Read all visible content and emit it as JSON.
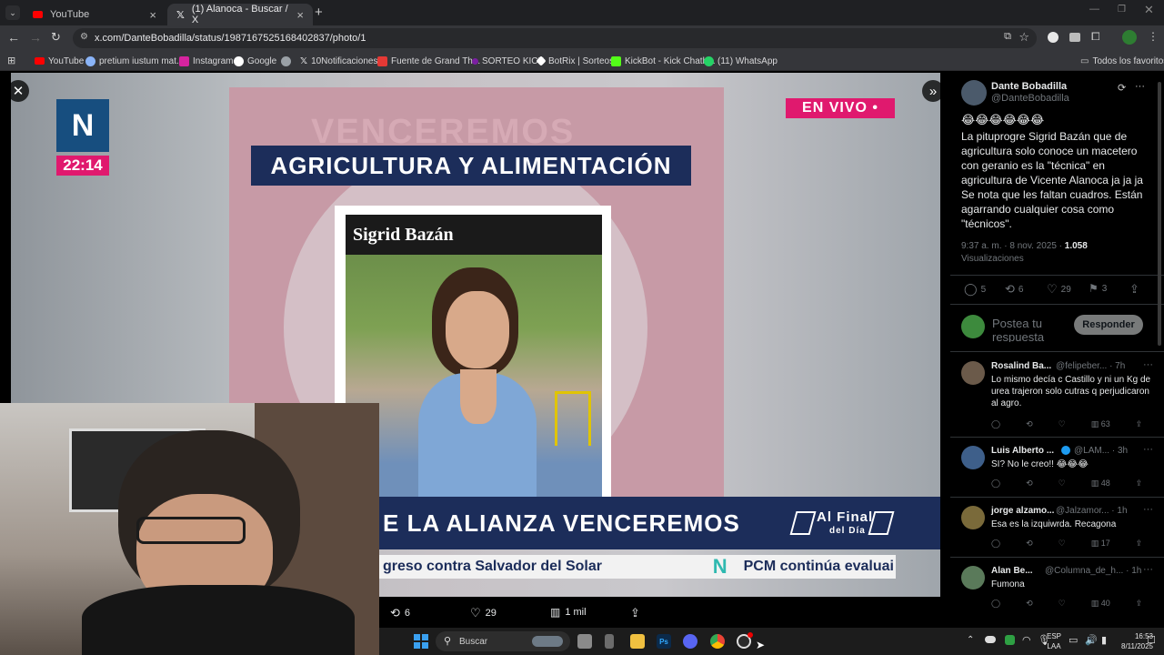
{
  "browser": {
    "tabs": [
      {
        "label": "YouTube",
        "active": false
      },
      {
        "label": "(1) Alanoca - Buscar / X",
        "active": true
      }
    ],
    "new_tab": "+",
    "url": "x.com/DanteBobadilla/status/1987167525168402837/photo/1",
    "bookmarks": [
      {
        "label": "YouTube",
        "color": "#ff0000"
      },
      {
        "label": "pretium iustum mat...",
        "color": "#8ab4f8"
      },
      {
        "label": "Instagram",
        "color": "#d6249f"
      },
      {
        "label": "Google",
        "color": "#ffffff"
      },
      {
        "label": "",
        "color": "#9aa0a6"
      },
      {
        "label": "10Notificaciones",
        "color": "#ffffff"
      },
      {
        "label": "Fuente de Grand Th...",
        "color": "#e53935"
      },
      {
        "label": "SORTEO KICK",
        "color": "#7b1fa2"
      },
      {
        "label": "BotRix | Sorteos",
        "color": "#ffffff"
      },
      {
        "label": "KickBot - Kick Chatb...",
        "color": "#53fc18"
      },
      {
        "label": "(11) WhatsApp",
        "color": "#25d366"
      }
    ],
    "all_bookmarks": "Todos los favoritos"
  },
  "photo": {
    "channel_clock": "22:14",
    "live_badge": "EN VIVO •",
    "watermark": "VENCEREMOS",
    "banner": "AGRICULTURA Y ALIMENTACIÓN",
    "card_name": "Sigrid Bazán",
    "lower_third": "E LA ALIANZA VENCEREMOS",
    "program_logo_line1": "Al Final",
    "program_logo_line2": "del Día",
    "ticker_left": "greso contra Salvador del Solar",
    "ticker_right": "PCM continúa evaluai"
  },
  "photo_actions": {
    "retweets": "6",
    "likes": "29",
    "views": "1 mil"
  },
  "post": {
    "author_name": "Dante Bobadilla",
    "author_handle": "@DanteBobadilla",
    "emoji": "😂😂😂😂😂😂",
    "text": "La pituprogre Sigrid Bazán que de agricultura solo conoce un macetero con geranio es la \"técnica\" en agricultura de Vicente Alanoca ja ja ja Se nota que les faltan cuadros. Están agarrando cualquier cosa como \"técnicos\".",
    "time": "9:37 a. m. · 8 nov. 2025 · ",
    "views_count": "1.058",
    "views_label": "Visualizaciones",
    "replies": "5",
    "reposts": "6",
    "likes": "29",
    "bookmarks": "3",
    "reply_placeholder": "Postea tu respuesta",
    "reply_button": "Responder"
  },
  "replies": [
    {
      "name": "Rosalind Ba...",
      "handle": "@felipeber...",
      "time": "· 7h",
      "text": "Lo mismo decía c Castillo y ni un Kg de urea trajeron solo cutras q perjudicaron al agro.",
      "views": "63",
      "avatar_color": "#6b5a4a"
    },
    {
      "name": "Luis Alberto ...",
      "handle": "@LAM...",
      "time": "· 3h",
      "text": "SI? No le creo!! 😂😂😂",
      "views": "48",
      "avatar_color": "#3e5f8a"
    },
    {
      "name": "jorge alzamo...",
      "handle": "@Jalzamor...",
      "time": "· 1h",
      "text": "Esa es la izquiwrda. Recagona",
      "views": "17",
      "avatar_color": "#7a6a3a"
    },
    {
      "name": "Alan Be...",
      "handle": "@Columna_de_h...",
      "time": "· 1h",
      "text": "Fumona",
      "views": "40",
      "avatar_color": "#5a7a5a"
    }
  ],
  "taskbar": {
    "search": "Buscar",
    "lang_line1": "ESP",
    "lang_line2": "LAA",
    "time": "16:53",
    "date": "8/11/2025"
  }
}
